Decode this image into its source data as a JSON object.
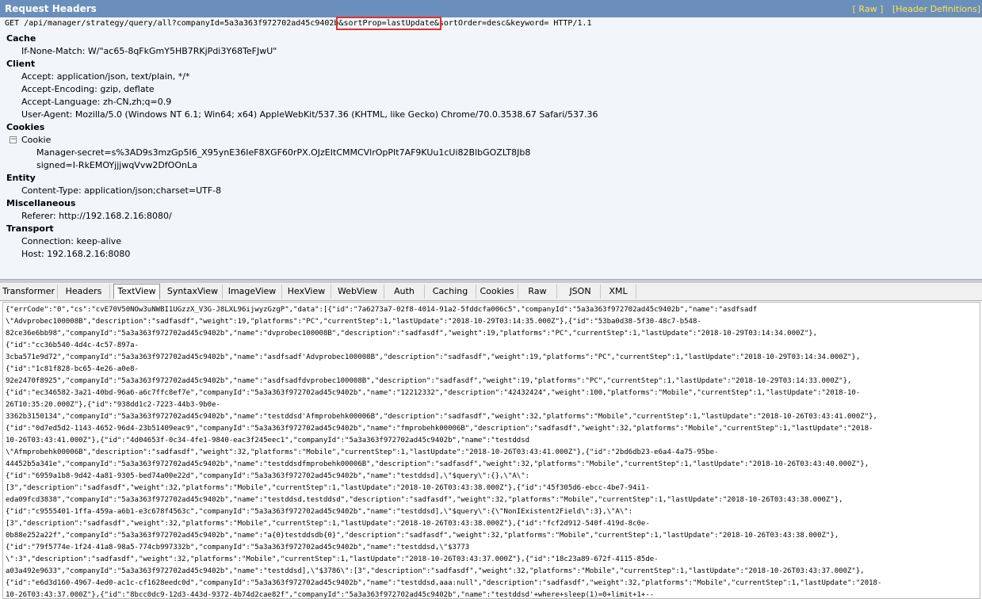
{
  "header": {
    "title": "Request Headers",
    "raw_link": "[ Raw ]",
    "defs_link": "[Header Definitions]"
  },
  "request_line": {
    "pre": "GET /api/manager/strategy/query/all?companyId=5a3a363f972702ad45c9402b",
    "highlight": "&sortProp=lastUpdate&",
    "post": "sortOrder=desc&keyword= HTTP/1.1"
  },
  "sections": {
    "cache": {
      "title": "Cache",
      "lines": [
        "If-None-Match: W/\"ac65-8qFkGmY5HB7RKjPdi3Y68TeFJwU\""
      ]
    },
    "client": {
      "title": "Client",
      "lines": [
        "Accept: application/json, text/plain, */*",
        "Accept-Encoding: gzip, deflate",
        "Accept-Language: zh-CN,zh;q=0.9",
        "User-Agent: Mozilla/5.0 (Windows NT 6.1; Win64; x64) AppleWebKit/537.36 (KHTML, like Gecko) Chrome/70.0.3538.67 Safari/537.36"
      ]
    },
    "cookies": {
      "title": "Cookies",
      "toggle": "−",
      "group": "Cookie",
      "lines": [
        "Manager-secret=s%3AD9s3mzGp5I6_X95ynE36IeF8XGF60rPX.OJzEItCMMCVlrOpPIt7AF9KUu1cUi82BlbGOZLT8Jb8",
        "signed=I-RkEMOYjjjwqVvw2DfOOnLa"
      ]
    },
    "entity": {
      "title": "Entity",
      "lines": [
        "Content-Type: application/json;charset=UTF-8"
      ]
    },
    "misc": {
      "title": "Miscellaneous",
      "lines": [
        "Referer: http://192.168.2.16:8080/"
      ]
    },
    "transport": {
      "title": "Transport",
      "lines": [
        "Connection: keep-alive",
        "Host: 192.168.2.16:8080"
      ]
    }
  },
  "tabs": [
    "Transformer",
    "Headers",
    "TextView",
    "SyntaxView",
    "ImageView",
    "HexView",
    "WebView",
    "Auth",
    "Caching",
    "Cookies",
    "Raw",
    "JSON",
    "XML"
  ],
  "active_tab": "TextView",
  "body_lines": [
    "{\"errCode\":\"0\",\"cs\":\"cvE70V50NOw3uNWBI1UGzzX_V3G-J8LXL96ijwyzGzgP\",\"data\":[{\"id\":\"7a6273a7-02f8-4014-91a2-5fddcfa006c5\",\"companyId\":\"5a3a363f972702ad45c9402b\",\"name\":\"asdfsadf",
    "\\\"Advprobec100008B\",\"description\":\"sadfasdf\",\"weight\":19,\"platforms\":\"PC\",\"currentStep\":1,\"lastUpdate\":\"2018-10-29T03:14:35.000Z\"},{\"id\":\"53ba0d38-5f30-48c7-b548-",
    "82ce36e6bb98\",\"companyId\":\"5a3a363f972702ad45c9402b\",\"name\":\"dvprobec100008B\",\"description\":\"sadfasdf\",\"weight\":19,\"platforms\":\"PC\",\"currentStep\":1,\"lastUpdate\":\"2018-10-29T03:14:34.000Z\"},",
    "{\"id\":\"cc36b540-4d4c-4c57-897a-",
    "3cba571e9d72\",\"companyId\":\"5a3a363f972702ad45c9402b\",\"name\":\"asdfsadf'Advprobec100008B\",\"description\":\"sadfasdf\",\"weight\":19,\"platforms\":\"PC\",\"currentStep\":1,\"lastUpdate\":\"2018-10-29T03:14:34.000Z\"},",
    "{\"id\":\"1c81f828-bc65-4e26-a0e8-",
    "92e2470f8925\",\"companyId\":\"5a3a363f972702ad45c9402b\",\"name\":\"asdfsadfdvprobec100008B\",\"description\":\"sadfasdf\",\"weight\":19,\"platforms\":\"PC\",\"currentStep\":1,\"lastUpdate\":\"2018-10-29T03:14:33.000Z\"},",
    "{\"id\":\"ec346582-3a21-40bd-96a6-a6c7ffc8ef7e\",\"companyId\":\"5a3a363f972702ad45c9402b\",\"name\":\"12212332\",\"description\":\"42432424\",\"weight\":100,\"platforms\":\"Mobile\",\"currentStep\":1,\"lastUpdate\":\"2018-10-",
    "26T10:35:20.000Z\"},{\"id\":\"938dd1c2-7223-44b3-9b0e-",
    "3362b3150134\",\"companyId\":\"5a3a363f972702ad45c9402b\",\"name\":\"testddsd'Afmprobehk00006B\",\"description\":\"sadfasdf\",\"weight\":32,\"platforms\":\"Mobile\",\"currentStep\":1,\"lastUpdate\":\"2018-10-26T03:43:41.000Z\"},",
    "{\"id\":\"0d7ed5d2-1143-4652-96d4-23b51409eac9\",\"companyId\":\"5a3a363f972702ad45c9402b\",\"name\":\"fmprobehk00006B\",\"description\":\"sadfasdf\",\"weight\":32,\"platforms\":\"Mobile\",\"currentStep\":1,\"lastUpdate\":\"2018-",
    "10-26T03:43:41.000Z\"},{\"id\":\"4d04653f-0c34-4fe1-9840-eac3f245eec1\",\"companyId\":\"5a3a363f972702ad45c9402b\",\"name\":\"testddsd",
    "\\\"Afmprobehk00006B\",\"description\":\"sadfasdf\",\"weight\":32,\"platforms\":\"Mobile\",\"currentStep\":1,\"lastUpdate\":\"2018-10-26T03:43:41.000Z\"},{\"id\":\"2bd6db23-e6a4-4a75-95be-",
    "44452b5a341e\",\"companyId\":\"5a3a363f972702ad45c9402b\",\"name\":\"testddsdfmprobehk00006B\",\"description\":\"sadfasdf\",\"weight\":32,\"platforms\":\"Mobile\",\"currentStep\":1,\"lastUpdate\":\"2018-10-26T03:43:40.000Z\"},",
    "{\"id\":\"6959a1b8-9d42-4a81-9305-bed74a00e22d\",\"companyId\":\"5a3a363f972702ad45c9402b\",\"name\":\"testddsd],\\\"$query\\\":{},\\\"A\\\":",
    "[3\",\"description\":\"sadfasdf\",\"weight\":32,\"platforms\":\"Mobile\",\"currentStep\":1,\"lastUpdate\":\"2018-10-26T03:43:38.000Z\"},{\"id\":\"45f305d6-ebcc-4be7-94i1-",
    "eda09fcd3838\",\"companyId\":\"5a3a363f972702ad45c9402b\",\"name\":\"testddsd,testddsd\",\"description\":\"sadfasdf\",\"weight\":32,\"platforms\":\"Mobile\",\"currentStep\":1,\"lastUpdate\":\"2018-10-26T03:43:38.000Z\"},",
    "{\"id\":\"c9555401-1ffa-459a-a6b1-e3c678f4563c\",\"companyId\":\"5a3a363f972702ad45c9402b\",\"name\":\"testddsd],\\\"$query\\\":{\\\"NonIExistent2Field\\\":3},\\\"A\\\":",
    "[3\",\"description\":\"sadfasdf\",\"weight\":32,\"platforms\":\"Mobile\",\"currentStep\":1,\"lastUpdate\":\"2018-10-26T03:43:38.000Z\"},{\"id\":\"fcf2d912-540f-419d-8c0e-",
    "0b88e252a22f\",\"companyId\":\"5a3a363f972702ad45c9402b\",\"name\":\"a{0}testddsdb{0}\",\"description\":\"sadfasdf\",\"weight\":32,\"platforms\":\"Mobile\",\"currentStep\":1,\"lastUpdate\":\"2018-10-26T03:43:38.000Z\"},",
    "{\"id\":\"79f5774e-1f24-41a8-98a5-774cb997332b\",\"companyId\":\"5a3a363f972702ad45c9402b\",\"name\":\"testddsd,\\\"$3773",
    "\\\":3\",\"description\":\"sadfasdf\",\"weight\":32,\"platforms\":\"Mobile\",\"currentStep\":1,\"lastUpdate\":\"2018-10-26T03:43:37.000Z\"},{\"id\":\"18c23a89-672f-4115-85de-",
    "a03a492e9633\",\"companyId\":\"5a3a363f972702ad45c9402b\",\"name\":\"testddsd],\\\"$3786\\\":[3\",\"description\":\"sadfasdf\",\"weight\":32,\"platforms\":\"Mobile\",\"currentStep\":1,\"lastUpdate\":\"2018-10-26T03:43:37.000Z\"},",
    "{\"id\":\"e6d3d160-4967-4ed0-ac1c-cf1628eedc0d\",\"companyId\":\"5a3a363f972702ad45c9402b\",\"name\":\"testddsd,aaa:null\",\"description\":\"sadfasdf\",\"weight\":32,\"platforms\":\"Mobile\",\"currentStep\":1,\"lastUpdate\":\"2018-",
    "10-26T03:43:37.000Z\"},{\"id\":\"8bcc0dc9-12d3-443d-9372-4b74d2cae82f\",\"companyId\":\"5a3a363f972702ad45c9402b\",\"name\":\"testddsd'+where+sleep(1)=0+limit+1+--"
  ]
}
